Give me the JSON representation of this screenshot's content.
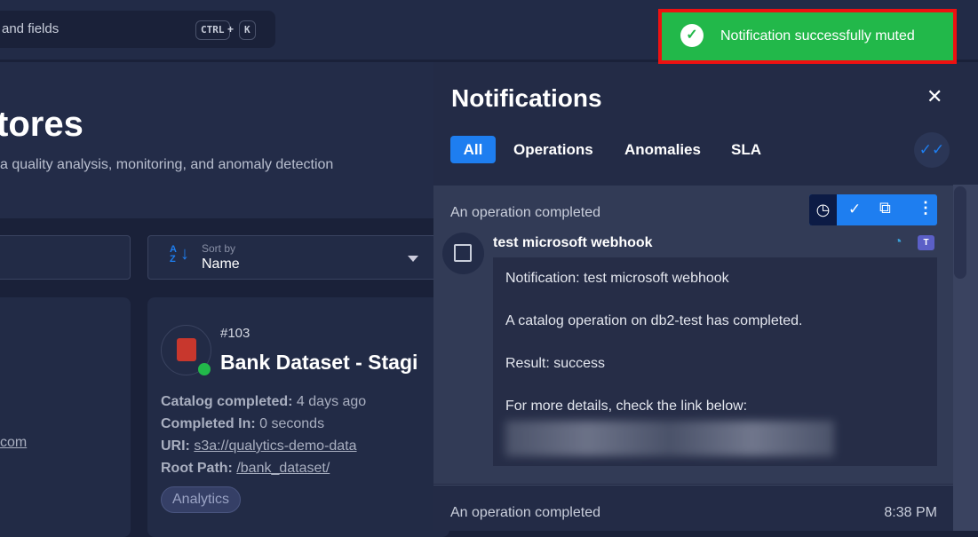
{
  "search": {
    "text": "and fields",
    "key1": "CTRL",
    "plus": "+",
    "key2": "K"
  },
  "hero": {
    "title": "tores",
    "subtitle": "a quality analysis, monitoring, and anomaly detection"
  },
  "sort": {
    "label": "Sort by",
    "value": "Name"
  },
  "card_left": {
    "link": "com"
  },
  "card": {
    "id": "#103",
    "title": "Bank Dataset - Stagi",
    "catalog_label": "Catalog completed:",
    "catalog_value": "4 days ago",
    "completed_label": "Completed In:",
    "completed_value": "0 seconds",
    "uri_label": "URI:",
    "uri_value": "s3a://qualytics-demo-data",
    "root_label": "Root Path:",
    "root_value": "/bank_dataset/",
    "tag": "Analytics",
    "status_color": "#22b84a"
  },
  "toast": {
    "message": "Notification successfully muted"
  },
  "notifications": {
    "title": "Notifications",
    "tabs": [
      {
        "label": "All",
        "active": true
      },
      {
        "label": "Operations"
      },
      {
        "label": "Anomalies"
      },
      {
        "label": "SLA"
      }
    ],
    "items": [
      {
        "heading": "An operation completed",
        "name": "test microsoft webhook",
        "lines": [
          "Notification: test microsoft webhook",
          "A catalog operation on db2-test has completed.",
          "Result: success",
          "For more details, check the link below:"
        ]
      },
      {
        "heading": "An operation completed",
        "time": "8:38 PM"
      }
    ]
  }
}
